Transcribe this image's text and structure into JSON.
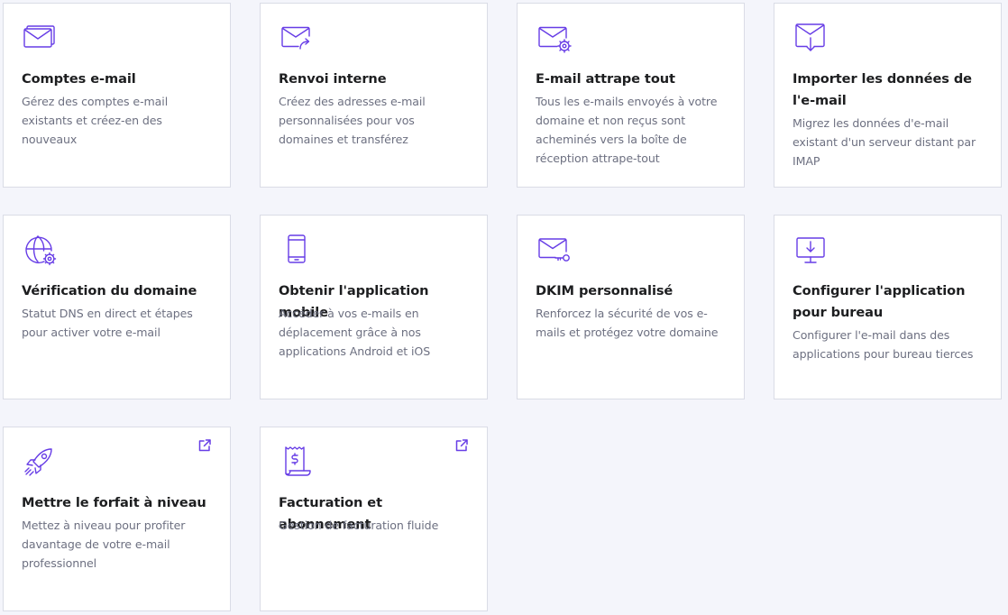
{
  "colors": {
    "accent": "#673de6",
    "background": "#f4f5fb",
    "card": "#ffffff",
    "title": "#1d1e20",
    "description": "#6d7081"
  },
  "cards": [
    {
      "icon": "email-accounts-icon",
      "title": "Comptes e-mail",
      "description": "Gérez des comptes e-mail existants et créez-en des nouveaux"
    },
    {
      "icon": "email-forward-icon",
      "title": "Renvoi interne",
      "description": "Créez des adresses e-mail personnalisées pour vos domaines et transférez"
    },
    {
      "icon": "email-settings-icon",
      "title": "E-mail attrape tout",
      "description": "Tous les e-mails envoyés à votre domaine et non reçus sont acheminés vers la boîte de réception attrape-tout"
    },
    {
      "icon": "email-import-icon",
      "title": "Importer les données de l'e-mail",
      "description": "Migrez les données d'e-mail existant d'un serveur distant par IMAP"
    },
    {
      "icon": "globe-settings-icon",
      "title": "Vérification du domaine",
      "description": "Statut DNS en direct et étapes pour activer votre e-mail"
    },
    {
      "icon": "mobile-phone-icon",
      "title": "Obtenir l'application mobile",
      "description": "Accéder à vos e-mails en déplacement grâce à nos applications Android et iOS"
    },
    {
      "icon": "email-key-icon",
      "title": "DKIM personnalisé",
      "description": "Renforcez la sécurité de vos e-mails et protégez votre domaine"
    },
    {
      "icon": "desktop-download-icon",
      "title": "Configurer l'application pour bureau",
      "description": "Configurer l'e-mail dans des applications pour bureau tierces"
    },
    {
      "icon": "rocket-icon",
      "title": "Mettre le forfait à niveau",
      "description": "Mettez à niveau pour profiter davantage de votre e-mail professionnel",
      "external": "external-link-icon"
    },
    {
      "icon": "receipt-dollar-icon",
      "title": "Facturation et abonnement",
      "description": "Gestion de facturation fluide",
      "external": "external-link-icon"
    }
  ]
}
